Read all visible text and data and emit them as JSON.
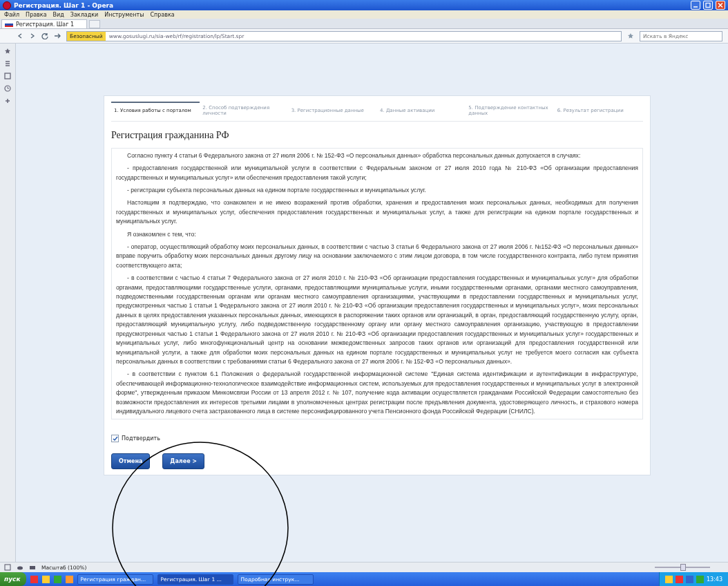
{
  "window": {
    "title": "Регистрация. Шаг 1 - Opera"
  },
  "menu": [
    "Файл",
    "Правка",
    "Вид",
    "Закладки",
    "Инструменты",
    "Справка"
  ],
  "tabs": [
    {
      "label": "Регистрация. Шаг 1",
      "selected": true
    }
  ],
  "address_bar": {
    "security_badge": "Безопасный",
    "url": "www.gosuslugi.ru/sia-web/rf/registration/lp/Start.spr",
    "search_placeholder": "Искать в Яндекс"
  },
  "steps": [
    {
      "label": "1. Условия работы с порталом",
      "selected": true
    },
    {
      "label": "2. Способ подтверждения личности",
      "selected": false
    },
    {
      "label": "3. Регистрационные данные",
      "selected": false
    },
    {
      "label": "4. Данные активации",
      "selected": false
    },
    {
      "label": "5. Подтверждение контактных данных",
      "selected": false
    },
    {
      "label": "6. Результат регистрации",
      "selected": false
    }
  ],
  "page_title": "Регистрация гражданина РФ",
  "consent_paragraphs": [
    "Согласно пункту 4 статьи 6 Федерального закона от 27 июля 2006 г. № 152-ФЗ «О персональных данных» обработка персональных данных допускается в случаях:",
    "- предоставления государственной или муниципальной услуги в соответствии с Федеральным законом от 27 июля 2010 года № 210-ФЗ «Об организации предоставления государственных и муниципальных услуг» или обеспечения предоставления такой услуги;",
    "- регистрации субъекта персональных данных на едином портале государственных и муниципальных услуг.",
    "Настоящим я подтверждаю, что ознакомлен и не имею возражений против обработки, хранения и предоставления моих персональных данных, необходимых для получения государственных и муниципальных услуг, обеспечения предоставления государственных и муниципальных услуг, а также для регистрации на едином портале государственных и муниципальных услуг.",
    "Я ознакомлен с тем, что:",
    "- оператор, осуществляющий обработку моих персональных данных, в соответствии с частью 3 статьи 6 Федерального закона от 27 июля 2006 г. №152-ФЗ «О персональных данных» вправе поручить обработку моих персональных данных другому лицу на основании заключаемого с этим лицом договора, в том числе государственного контракта, либо путем принятия соответствующего акта;",
    "- в соответствии с частью 4 статьи 7 Федерального закона от 27 июля 2010 г. № 210-ФЗ «Об организации предоставления государственных и муниципальных услуг» для обработки органами, предоставляющими государственные услуги, органами, предоставляющими муниципальные услуги, иными государственными органами, органами местного самоуправления, подведомственными государственным органам или органам местного самоуправления организациями, участвующими в предоставлении государственных и муниципальных услуг, предусмотренных частью 1 статьи 1 Федерального закона от 27 июля 2010 г. № 210-ФЗ «Об организации предоставления государственных и муниципальных услуг», моих персональных данных в целях предоставления указанных персональных данных, имеющихся в распоряжении таких органов или организаций, в орган, предоставляющий государственную услугу, орган, предоставляющий муниципальную услугу, либо подведомственную государственному органу или органу местного самоуправления организацию, участвующую в предоставлении предусмотренных частью 1 статьи 1 Федерального закона от 27 июля 2010 г. № 210-ФЗ «Об организации предоставления государственных и муниципальных услуг» государственных и муниципальных услуг, либо многофункциональный центр на основании межведомственных запросов таких органов или организаций для предоставления государственной или муниципальной услуги, а также для обработки моих персональных данных на едином портале государственных и муниципальных услуг не требуется моего согласия как субъекта персональных данных в соответствии с требованиями статьи 6 Федерального закона от 27 июля 2006 г. № 152-ФЗ «О персональных данных».",
    "- в соответствии с пунктом 6.1 Положения о федеральной государственной информационной системе \"Единая система идентификации и аутентификации в инфраструктуре, обеспечивающей информационно-технологическое взаимодействие информационных систем, используемых для предоставления государственных и муниципальных услуг в электронной форме\", утвержденным приказом Минкомсвязи России от 13 апреля 2012 г. № 107, получение кода активации осуществляется гражданами Российской Федерации самостоятельно без возможности предоставления их интересов третьими лицами в уполномоченных центрах регистрации после предъявления документа, удостоверяющего личность, и страхового номера индивидуального лицевого счета застрахованного лица в системе персонифицированного учета Пенсионного фонда Российской Федерации (СНИЛС)."
  ],
  "confirm": {
    "label": "Подтвердить",
    "checked": true
  },
  "buttons": [
    {
      "label": "Отмена"
    },
    {
      "label": "Далее >"
    }
  ],
  "status_bar": {
    "zoom": "Масштаб (100%)",
    "zoom_slider": {
      "level": 0.5
    }
  },
  "taskbar": {
    "start": "пуск",
    "tasks": [
      {
        "label": "Регистрация граждан...",
        "selected": false
      },
      {
        "label": "Регистрация. Шаг 1 ...",
        "selected": true
      },
      {
        "label": "Подробная инструк...",
        "selected": false
      }
    ],
    "clock": "13:43"
  }
}
